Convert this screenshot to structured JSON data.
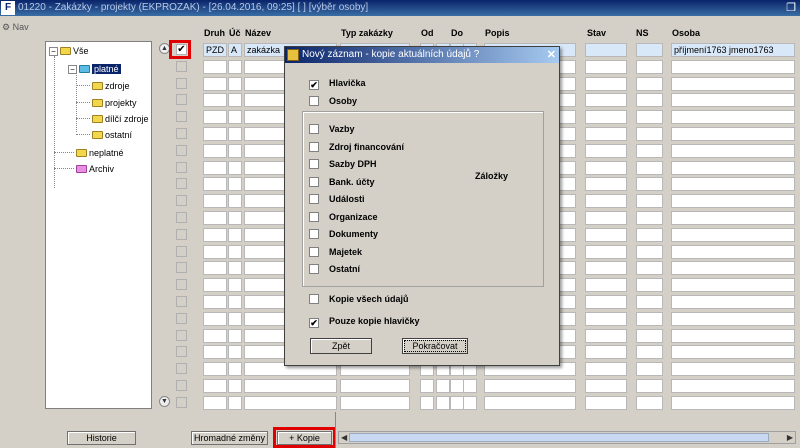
{
  "window": {
    "title": "01220 - Zakázky - projekty (EKPROZAK) - [26.04.2016, 09:25] [ ] [výběr osoby]",
    "app_icon": "F",
    "restore_icon": "restore-icon"
  },
  "nav": {
    "label": "Nav"
  },
  "tree": {
    "root": "Vše",
    "selected": "platné",
    "children": [
      "zdroje",
      "projekty",
      "dílčí zdroje",
      "ostatní"
    ],
    "neplatne": "neplatné",
    "archiv": "Archiv"
  },
  "grid": {
    "headers": [
      "Druh",
      "Úč",
      "Název",
      "Typ zakázky",
      "Od",
      "Do",
      "Popis",
      "Stav",
      "NS",
      "Osoba"
    ],
    "first_row": {
      "druh": "PZD",
      "uc": "A",
      "nazev": "zakázka",
      "osoba": "příjmení1763 jmeno1763"
    }
  },
  "dialog": {
    "title": "Nový záznam - kopie aktuálních údajů ?",
    "close": "✕",
    "group_label": "Záložky",
    "hlavicka": {
      "label": "Hlavička",
      "checked": "✔"
    },
    "osoby": {
      "label": "Osoby"
    },
    "items": [
      "Vazby",
      "Zdroj financování",
      "Sazby DPH",
      "Bank. účty",
      "Události",
      "Organizace",
      "Dokumenty",
      "Majetek",
      "Ostatní"
    ],
    "kopie_vsech": {
      "label": "Kopie všech údajů"
    },
    "pouze_hlavicky": {
      "label": "Pouze kopie hlavičky",
      "checked": "✔"
    },
    "back_button": "Zpět",
    "continue_button": "Pokračovat"
  },
  "footer": {
    "historie": "Historie",
    "hromadne": "Hromadné změny",
    "kopie": "+ Kopie"
  },
  "colors": {
    "highlight": "#e00000",
    "title_bar": "#0a246a"
  }
}
